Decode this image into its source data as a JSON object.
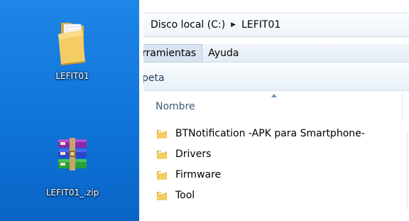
{
  "desktop": {
    "icons": [
      {
        "label": "LEFIT01",
        "icon": "folder-icon"
      },
      {
        "label": "LEFIT01_.zip",
        "icon": "winrar-archive-icon"
      }
    ]
  },
  "explorer": {
    "breadcrumb": [
      "Disco local (C:)",
      "LEFIT01"
    ],
    "breadcrumb_separator": "▶",
    "menu": [
      "rramientas",
      "Ayuda"
    ],
    "toolbar": {
      "command": "peta"
    },
    "columns": {
      "name": "Nombre"
    },
    "files": [
      {
        "name": "BTNotification -APK para Smartphone-",
        "icon": "folder-icon"
      },
      {
        "name": "Drivers",
        "icon": "folder-icon"
      },
      {
        "name": "Firmware",
        "icon": "folder-icon"
      },
      {
        "name": "Tool",
        "icon": "folder-icon"
      }
    ]
  },
  "colors": {
    "desktop_blue": "#0f74d8",
    "folder_yellow": "#f1c75a",
    "header_text": "#3c5a7a"
  }
}
